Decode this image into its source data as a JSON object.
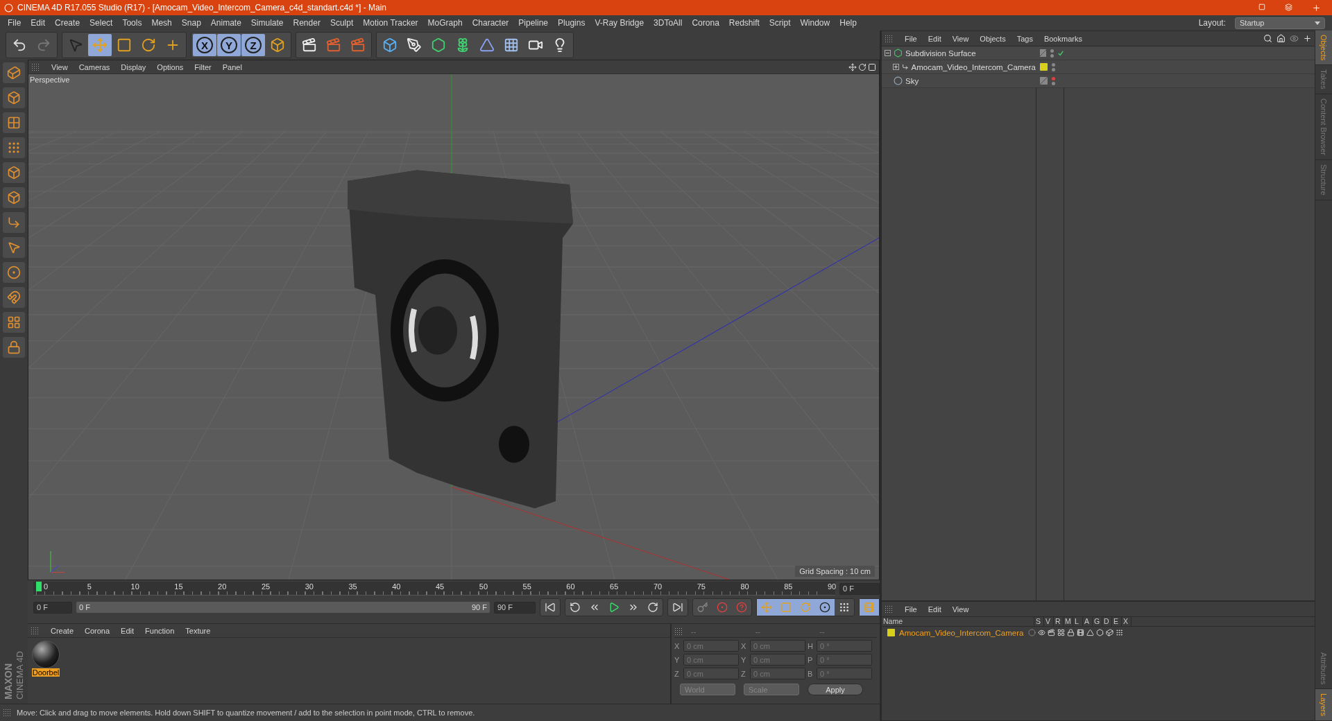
{
  "window": {
    "title": "CINEMA 4D R17.055 Studio (R17) - [Amocam_Video_Intercom_Camera_c4d_standart.c4d *] - Main"
  },
  "menu": [
    "File",
    "Edit",
    "Create",
    "Select",
    "Tools",
    "Mesh",
    "Snap",
    "Animate",
    "Simulate",
    "Render",
    "Sculpt",
    "Motion Tracker",
    "MoGraph",
    "Character",
    "Pipeline",
    "Plugins",
    "V-Ray Bridge",
    "3DToAll",
    "Corona",
    "Redshift",
    "Script",
    "Window",
    "Help"
  ],
  "layout": {
    "label": "Layout:",
    "value": "Startup"
  },
  "toolbar": [
    [
      {
        "kind": "undo",
        "selected": false
      },
      {
        "kind": "redo",
        "selected": false
      }
    ],
    [
      {
        "kind": "pointer",
        "selected": false
      },
      {
        "kind": "move",
        "selected": true
      },
      {
        "kind": "scale",
        "selected": false
      },
      {
        "kind": "rotate",
        "selected": false
      },
      {
        "kind": "add",
        "selected": false
      }
    ],
    [
      {
        "kind": "axis",
        "label": "X",
        "selected": true
      },
      {
        "kind": "axis",
        "label": "Y",
        "selected": true
      },
      {
        "kind": "axis",
        "label": "Z",
        "selected": true
      },
      {
        "kind": "coord",
        "selected": false
      }
    ],
    [
      {
        "kind": "render-view",
        "selected": false
      },
      {
        "kind": "render",
        "selected": false
      },
      {
        "kind": "render-settings",
        "selected": false
      }
    ],
    [
      {
        "kind": "cube",
        "selected": false
      },
      {
        "kind": "pen",
        "selected": false
      },
      {
        "kind": "subdivision",
        "selected": false
      },
      {
        "kind": "cloner",
        "selected": false
      },
      {
        "kind": "deformer",
        "selected": false
      },
      {
        "kind": "floor",
        "selected": false
      },
      {
        "kind": "camera",
        "selected": false
      },
      {
        "kind": "light",
        "selected": false
      }
    ]
  ],
  "left_tools": [
    {
      "kind": "model"
    },
    {
      "kind": "object"
    },
    {
      "kind": "texture"
    },
    {
      "kind": "points"
    },
    {
      "kind": "edges"
    },
    {
      "kind": "polygons"
    },
    {
      "kind": "axis"
    },
    {
      "kind": "tweak"
    },
    {
      "kind": "snap"
    },
    {
      "kind": "magnet"
    },
    {
      "kind": "workplane"
    },
    {
      "kind": "lock"
    }
  ],
  "viewport": {
    "menu": [
      "View",
      "Cameras",
      "Display",
      "Options",
      "Filter",
      "Panel"
    ],
    "label": "Perspective",
    "grid_spacing": "Grid Spacing : 10 cm"
  },
  "timeline": {
    "ticks": [
      "0",
      "5",
      "10",
      "15",
      "20",
      "25",
      "30",
      "35",
      "40",
      "45",
      "50",
      "55",
      "60",
      "65",
      "70",
      "75",
      "80",
      "85",
      "90"
    ],
    "level": 0,
    "current": "0 F",
    "start": "0 F",
    "range": {
      "start": "0 F",
      "end": "90 F",
      "level": 1
    },
    "end": "90 F"
  },
  "materials": {
    "menu": [
      "Create",
      "Corona",
      "Edit",
      "Function",
      "Texture"
    ],
    "items": [
      {
        "name": "Doorbel",
        "selected": true
      }
    ]
  },
  "coordinates": {
    "headers": [
      "--",
      "--",
      "--"
    ],
    "rows": [
      {
        "axis_a": "X",
        "a": "0 cm",
        "axis_b": "X",
        "b": "0 cm",
        "axis_c": "H",
        "c": "0 °"
      },
      {
        "axis_a": "Y",
        "a": "0 cm",
        "axis_b": "Y",
        "b": "0 cm",
        "axis_c": "P",
        "c": "0 °"
      },
      {
        "axis_a": "Z",
        "a": "0 cm",
        "axis_b": "Z",
        "b": "0 cm",
        "axis_c": "B",
        "c": "0 °"
      }
    ],
    "space": "World",
    "mode": "Scale",
    "apply": "Apply"
  },
  "status_bar": "Move: Click and drag to move elements. Hold down SHIFT to quantize movement / add to the selection in point mode, CTRL to remove.",
  "logo": {
    "brand": "MAXON",
    "product": "CINEMA 4D"
  },
  "objects": {
    "menu": [
      "File",
      "Edit",
      "View",
      "Objects",
      "Tags",
      "Bookmarks"
    ],
    "tree": [
      {
        "name": "Subdivision Surface",
        "kind": "subdivision",
        "expanded": true,
        "editor_visible": true,
        "check": true,
        "children": [
          {
            "name": "Amocam_Video_Intercom_Camera",
            "kind": "null",
            "expanded": false,
            "editor_visible": true,
            "check": false,
            "color": "#d8cf1c"
          }
        ]
      },
      {
        "name": "Sky",
        "kind": "sky",
        "editor_visible": false,
        "check": false
      }
    ]
  },
  "right_tabs": [
    {
      "label": "Objects",
      "selected": true
    },
    {
      "label": "Takes",
      "selected": false
    },
    {
      "label": "Content Browser",
      "selected": false
    },
    {
      "label": "Structure",
      "selected": false
    }
  ],
  "layers": {
    "menu": [
      "File",
      "Edit",
      "View"
    ],
    "columns": [
      "Name",
      "S",
      "V",
      "R",
      "M",
      "L",
      "A",
      "G",
      "D",
      "E",
      "X"
    ],
    "rows": [
      {
        "name": "Amocam_Video_Intercom_Camera",
        "color": "#d8cf1c"
      }
    ]
  },
  "lower_tabs": [
    {
      "label": "Attributes",
      "selected": false
    },
    {
      "label": "Layers",
      "selected": true
    }
  ]
}
